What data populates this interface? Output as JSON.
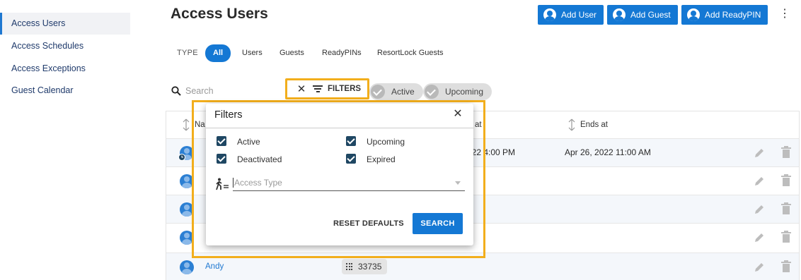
{
  "sidebar": {
    "items": [
      {
        "label": "Access Users",
        "active": true
      },
      {
        "label": "Access Schedules"
      },
      {
        "label": "Access Exceptions"
      },
      {
        "label": "Guest Calendar"
      }
    ]
  },
  "header": {
    "title": "Access Users",
    "add_user": "Add User",
    "add_guest": "Add Guest",
    "add_readypin": "Add ReadyPIN",
    "more_icon": "kebab-menu-icon"
  },
  "type_filter": {
    "label": "TYPE",
    "options": [
      "All",
      "Users",
      "Guests",
      "ReadyPINs",
      "ResortLock Guests"
    ],
    "selected": "All"
  },
  "search": {
    "placeholder": "Search",
    "value": ""
  },
  "filters_button": {
    "label": "FILTERS"
  },
  "status_chips": [
    "Active",
    "Upcoming"
  ],
  "table": {
    "columns": [
      "Na",
      "at",
      "Ends at"
    ],
    "rows": [
      {
        "name": "",
        "starts_partial": "022 4:00 PM",
        "ends": "Apr 26, 2022 11:00 AM",
        "pin": ""
      },
      {
        "name": "",
        "starts_partial": "",
        "ends": "",
        "pin": ""
      },
      {
        "name": "",
        "starts_partial": "",
        "ends": "",
        "pin": ""
      },
      {
        "name": "",
        "starts_partial": "",
        "ends": "",
        "pin": ""
      },
      {
        "name": "Andy",
        "starts_partial": "",
        "ends": "",
        "pin": "33735"
      }
    ]
  },
  "filter_dialog": {
    "title": "Filters",
    "checkboxes": [
      {
        "label": "Active",
        "checked": true
      },
      {
        "label": "Upcoming",
        "checked": true
      },
      {
        "label": "Deactivated",
        "checked": true
      },
      {
        "label": "Expired",
        "checked": true
      }
    ],
    "access_type_placeholder": "Access Type",
    "reset_label": "RESET DEFAULTS",
    "search_label": "SEARCH"
  },
  "colors": {
    "primary": "#1478d4",
    "highlight": "#f2ae1c",
    "checkbox": "#1f4763",
    "link": "#1f78d1"
  }
}
